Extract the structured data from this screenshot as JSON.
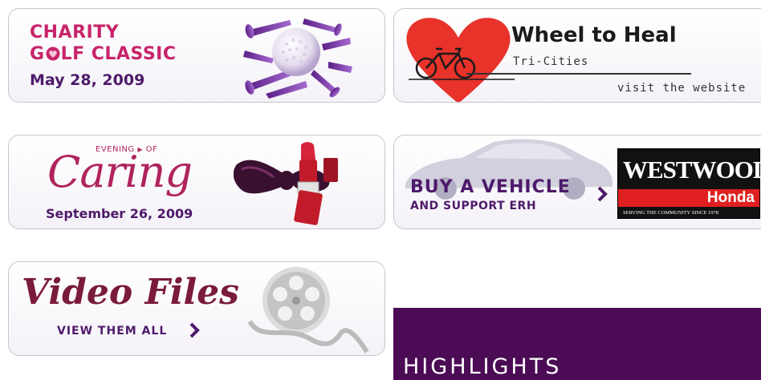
{
  "golf": {
    "line1": "CHARITY",
    "line2_g": "G",
    "line2_rest": "LF CLASSIC",
    "date": "May 28, 2009"
  },
  "wheel": {
    "title": "Wheel to Heal",
    "subtitle": "Tri-Cities",
    "link": "visit the website"
  },
  "caring": {
    "eyebrow_a": "EVENING",
    "eyebrow_b": "OF",
    "script": "Caring",
    "date": "September 26, 2009"
  },
  "vehicle": {
    "headline": "BUY A VEHICLE",
    "sub": "AND SUPPORT ERH",
    "dealer_name": "WESTWOOD",
    "dealer_brand": "Honda",
    "dealer_tagline": "SERVING THE COMMUNITY SINCE 1978"
  },
  "video": {
    "title": "Video Files",
    "sub": "VIEW THEM ALL"
  },
  "highlights": {
    "title": "HIGHLIGHTS"
  },
  "colors": {
    "accent_pink": "#c8246a",
    "accent_purple": "#4e1a6b",
    "highlights_bg": "#4b0b55",
    "heart_red": "#e8322a"
  }
}
